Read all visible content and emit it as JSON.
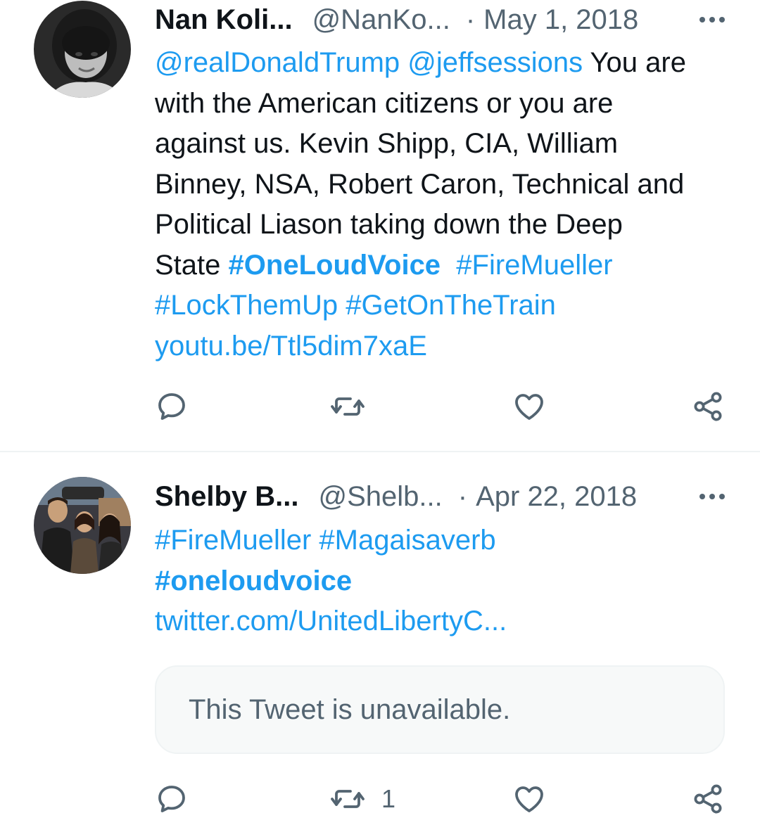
{
  "colors": {
    "link": "#1d9bf0",
    "text": "#0f1419",
    "secondary": "#536471",
    "divider": "#eff3f4"
  },
  "tweets": [
    {
      "author_name": "Nan Koli...",
      "handle": "@NanKo...",
      "separator": "·",
      "date": "May 1, 2018",
      "mention1": "@realDonaldTrump",
      "mention2": "@jeffsessions",
      "text_l1": "You are",
      "text_l2": "with the American citizens or you are",
      "text_l3": "against us. Kevin Shipp, CIA, William",
      "text_l4": "Binney, NSA, Robert Caron, Technical and",
      "text_l5": "Political Liason taking down the Deep",
      "text_l6": "State",
      "hashtag_onevoice": "#OneLoudVoice",
      "hashtag_firemueller": "#FireMueller",
      "hashtag_lockthemup": "#LockThemUp",
      "hashtag_getonthetrain": "#GetOnTheTrain",
      "url": "youtu.be/Ttl5dim7xaE",
      "icons": [
        "reply-icon",
        "retweet-icon",
        "like-icon",
        "share-icon"
      ]
    },
    {
      "author_name": "Shelby B...",
      "handle": "@Shelb...",
      "separator": "·",
      "date": "Apr 22, 2018",
      "hashtag_firemueller": "#FireMueller",
      "hashtag_magaisaverb": "#Magaisaverb",
      "hashtag_oneloudvoice": "#oneloudvoice",
      "url": "twitter.com/UnitedLibertyC...",
      "quote_text": "This Tweet is unavailable.",
      "retweet_count": "1",
      "icons": [
        "reply-icon",
        "retweet-icon",
        "like-icon",
        "share-icon"
      ]
    }
  ]
}
